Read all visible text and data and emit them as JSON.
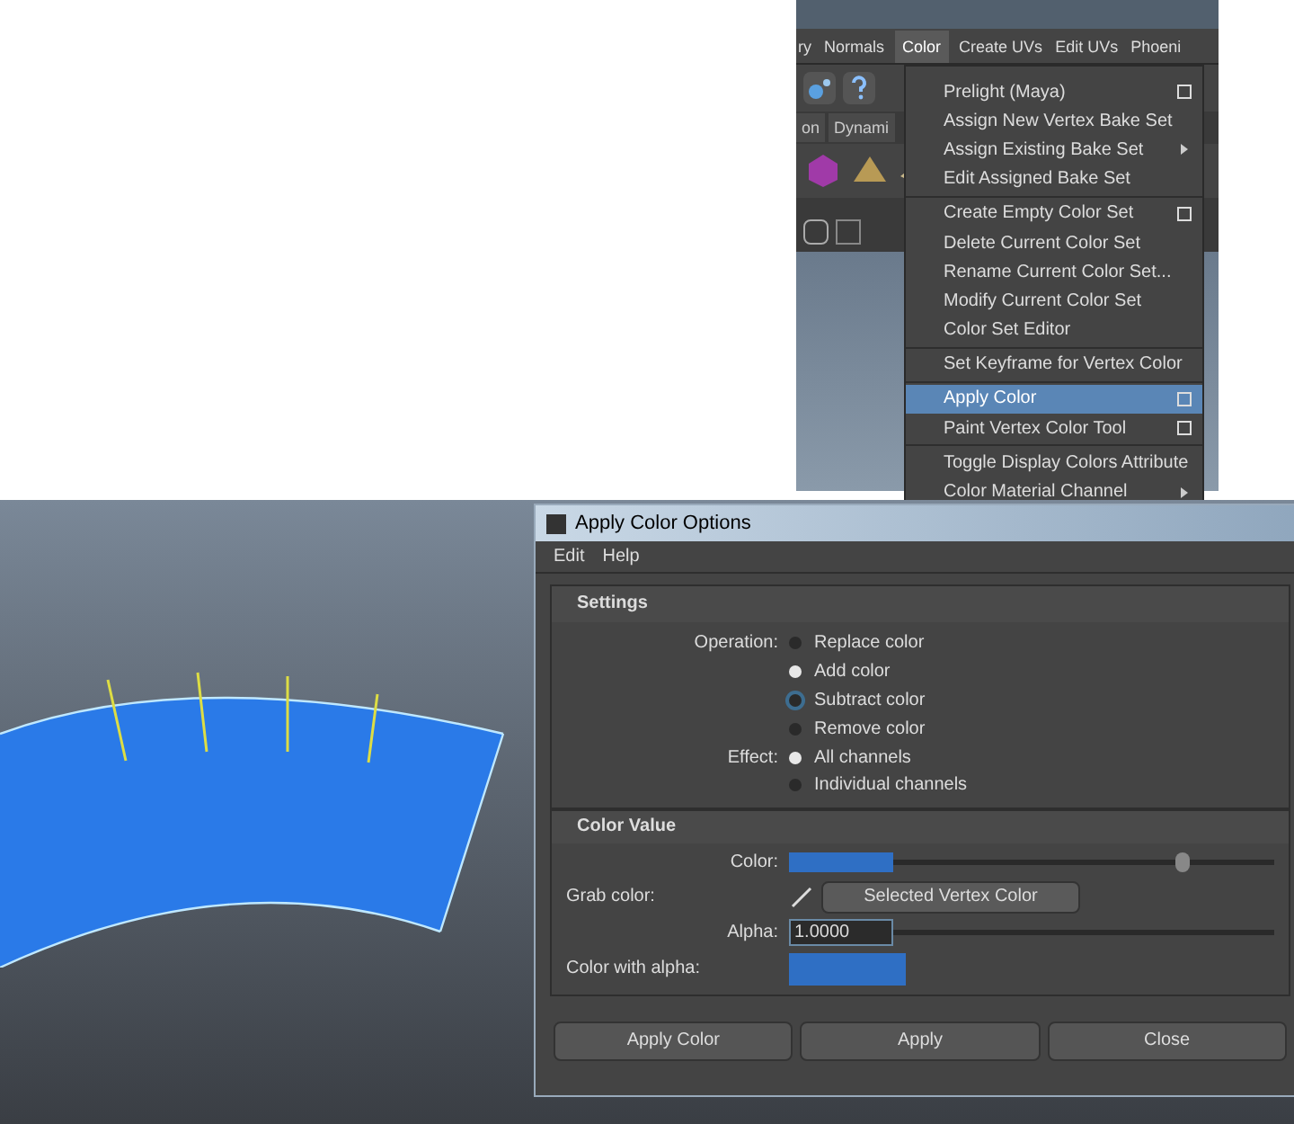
{
  "maya_menubar": {
    "items": [
      {
        "label": "ry",
        "selected": false
      },
      {
        "label": "Normals",
        "selected": false
      },
      {
        "label": "Color",
        "selected": true
      },
      {
        "label": "Create UVs",
        "selected": false
      },
      {
        "label": "Edit UVs",
        "selected": false
      },
      {
        "label": "Phoeni",
        "selected": false
      }
    ]
  },
  "shelf_tabs": [
    {
      "label": "on"
    },
    {
      "label": "Dynami"
    }
  ],
  "color_menu": {
    "items": [
      {
        "label": "Prelight (Maya)",
        "kind": "option",
        "separator_before": false,
        "selected": false
      },
      {
        "label": "Assign New Vertex Bake Set",
        "kind": "plain",
        "separator_before": false,
        "selected": false
      },
      {
        "label": "Assign Existing Bake Set",
        "kind": "submenu",
        "separator_before": false,
        "selected": false
      },
      {
        "label": "Edit Assigned Bake Set",
        "kind": "plain",
        "separator_before": false,
        "selected": false
      },
      {
        "label": "Create Empty Color Set",
        "kind": "option",
        "separator_before": true,
        "selected": false
      },
      {
        "label": "Delete Current Color Set",
        "kind": "plain",
        "separator_before": false,
        "selected": false
      },
      {
        "label": "Rename Current Color Set...",
        "kind": "plain",
        "separator_before": false,
        "selected": false
      },
      {
        "label": "Modify Current Color Set",
        "kind": "plain",
        "separator_before": false,
        "selected": false
      },
      {
        "label": "Color Set Editor",
        "kind": "plain",
        "separator_before": false,
        "selected": false
      },
      {
        "label": "Set Keyframe for Vertex Color",
        "kind": "plain",
        "separator_before": true,
        "selected": false
      },
      {
        "label": "Apply Color",
        "kind": "option",
        "separator_before": true,
        "selected": true
      },
      {
        "label": "Paint Vertex Color Tool",
        "kind": "option",
        "separator_before": false,
        "selected": false
      },
      {
        "label": "Toggle Display Colors Attribute",
        "kind": "plain",
        "separator_before": true,
        "selected": false
      },
      {
        "label": "Color Material Channel",
        "kind": "submenu",
        "separator_before": false,
        "selected": false
      }
    ]
  },
  "dialog": {
    "title": "Apply Color Options",
    "menu": [
      "Edit",
      "Help"
    ],
    "settings": {
      "title": "Settings",
      "operation": {
        "label": "Operation:",
        "options": [
          {
            "label": "Replace color",
            "selected": false,
            "hovered": false
          },
          {
            "label": "Add color",
            "selected": true,
            "hovered": false
          },
          {
            "label": "Subtract color",
            "selected": false,
            "hovered": true
          },
          {
            "label": "Remove color",
            "selected": false,
            "hovered": false
          }
        ]
      },
      "effect": {
        "label": "Effect:",
        "options": [
          {
            "label": "All channels",
            "selected": true,
            "hovered": false
          },
          {
            "label": "Individual channels",
            "selected": false,
            "hovered": false
          }
        ]
      }
    },
    "color_value": {
      "title": "Color Value",
      "color": {
        "label": "Color:",
        "color": "#2f6fc4",
        "level": 0.74
      },
      "grab_color": {
        "label": "Grab color:",
        "button": "Selected Vertex Color"
      },
      "alpha": {
        "label": "Alpha:",
        "value": "1.0000"
      },
      "color_with_alpha": {
        "label": "Color with alpha:",
        "color": "#2f6fc4"
      }
    },
    "buttons": [
      "Apply Color",
      "Apply",
      "Close"
    ]
  }
}
